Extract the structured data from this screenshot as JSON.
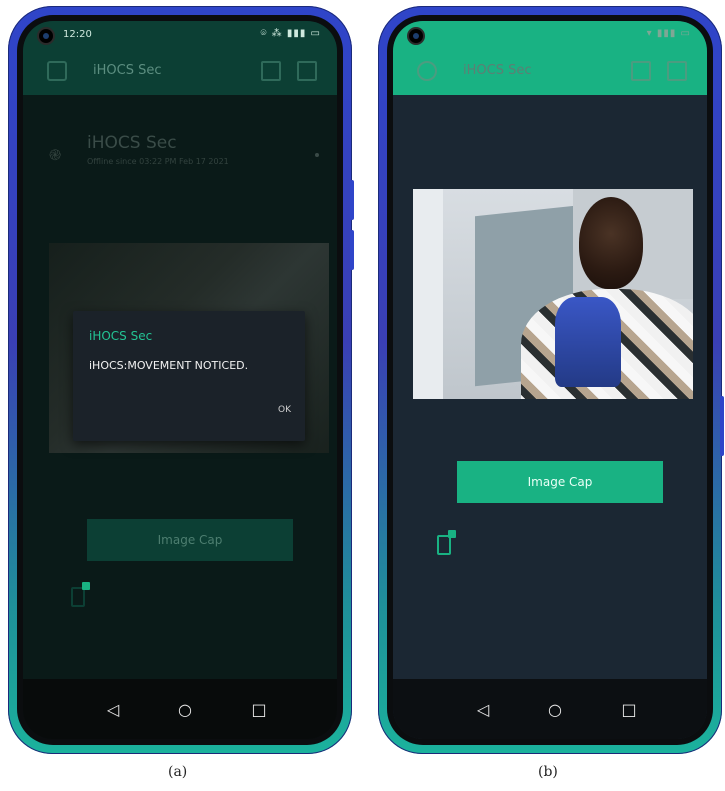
{
  "panel_a": {
    "caption": "(a)",
    "status_time": "12:20",
    "app_title": "iHOCS Sec",
    "widget_title": "iHOCS Sec",
    "widget_subtitle": "Offline since 03:22 PM Feb 17 2021",
    "dialog": {
      "title": "iHOCS Sec",
      "message": "iHOCS:MOVEMENT NOTICED.",
      "ok_label": "OK"
    },
    "image_cap_button": "Image Cap"
  },
  "panel_b": {
    "caption": "(b)",
    "app_title": "iHOCS Sec",
    "image_cap_button": "Image Cap"
  },
  "nav": {
    "back_glyph": "◁",
    "home_glyph": "○",
    "recent_glyph": "□"
  },
  "colors": {
    "accent_green": "#19b283",
    "dialog_title_green": "#23c394",
    "screen_bg": "#1b2733"
  }
}
